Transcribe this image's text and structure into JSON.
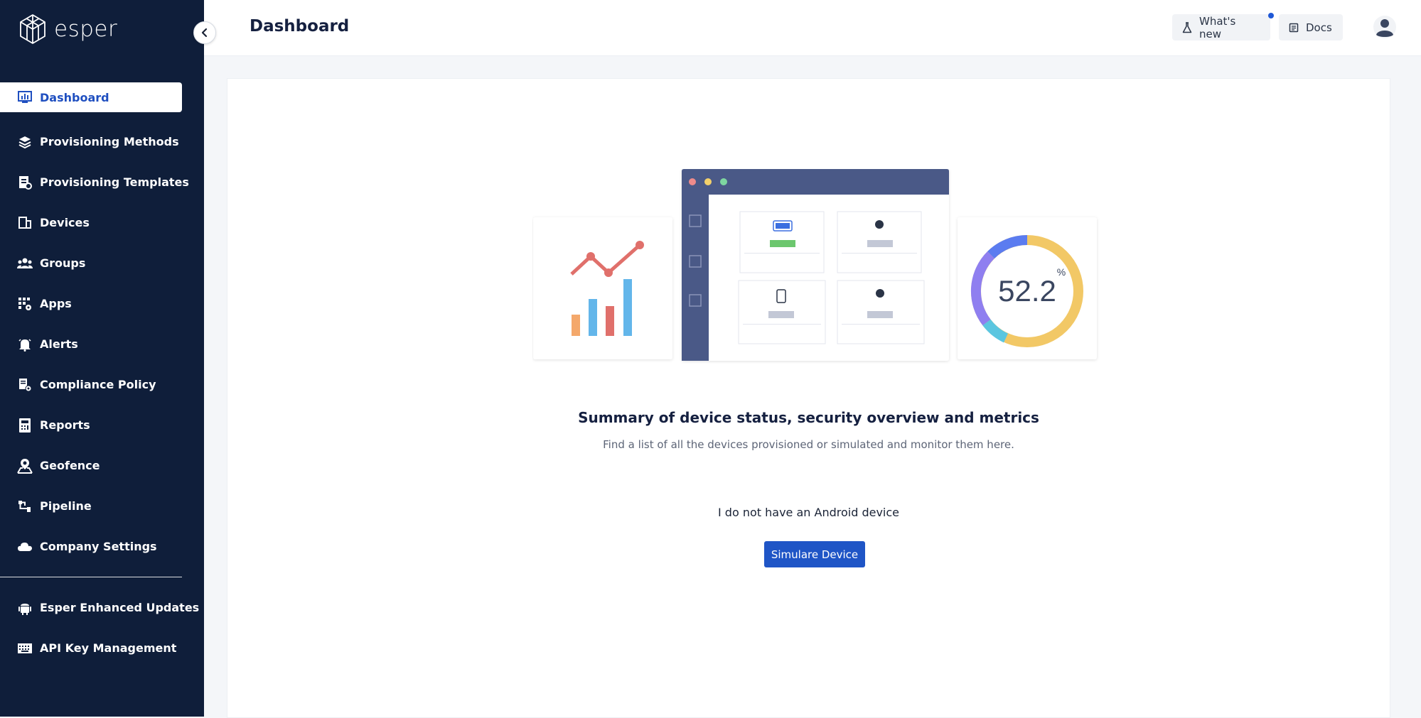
{
  "app": {
    "name": "esper"
  },
  "sidebar": {
    "items": [
      {
        "label": "Dashboard",
        "icon": "dashboard-icon",
        "active": true
      },
      {
        "label": "Provisioning Methods",
        "icon": "layers-icon"
      },
      {
        "label": "Provisioning Templates",
        "icon": "template-icon"
      },
      {
        "label": "Devices",
        "icon": "devices-icon"
      },
      {
        "label": "Groups",
        "icon": "groups-icon"
      },
      {
        "label": "Apps",
        "icon": "apps-icon"
      },
      {
        "label": "Alerts",
        "icon": "alerts-icon"
      },
      {
        "label": "Compliance Policy",
        "icon": "compliance-icon"
      },
      {
        "label": "Reports",
        "icon": "reports-icon"
      },
      {
        "label": "Geofence",
        "icon": "geofence-icon"
      },
      {
        "label": "Pipeline",
        "icon": "pipeline-icon"
      },
      {
        "label": "Company Settings",
        "icon": "cloud-icon"
      }
    ],
    "bottom_items": [
      {
        "label": "Esper Enhanced Updates",
        "icon": "android-icon"
      },
      {
        "label": "API Key Management",
        "icon": "keyboard-icon"
      }
    ]
  },
  "header": {
    "title": "Dashboard",
    "whats_new_label": "What's new",
    "docs_label": "Docs"
  },
  "main": {
    "gauge_value": "52.2",
    "gauge_unit": "%",
    "summary_title": "Summary of device status, security overview and metrics",
    "summary_subtitle": "Find a list of all the devices provisioned or simulated and monitor them here.",
    "android_text": "I do not have an Android device",
    "simulate_button": "Simulare Device"
  },
  "colors": {
    "sidebar_bg": "#0f1e3a",
    "accent": "#1f55c6",
    "notification_dot": "#1f58d6"
  }
}
